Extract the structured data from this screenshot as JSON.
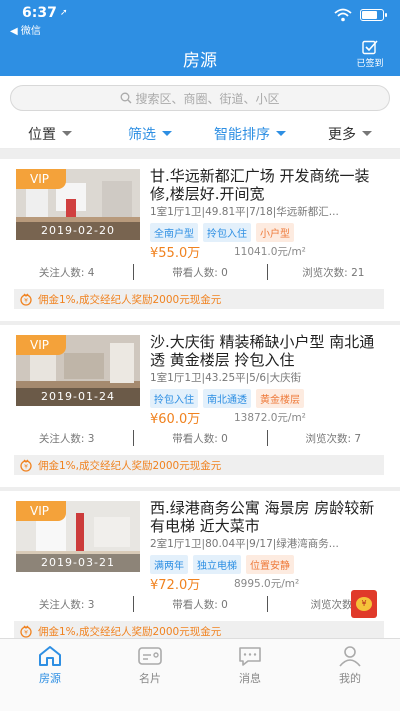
{
  "status_bar": {
    "time": "6:37",
    "back_app": "◀ 微信"
  },
  "header": {
    "title": "房源",
    "signin_label": "已签到"
  },
  "search": {
    "placeholder": "搜索区、商圈、街道、小区"
  },
  "filters": [
    {
      "label": "位置",
      "active": false
    },
    {
      "label": "筛选",
      "active": true
    },
    {
      "label": "智能排序",
      "active": true
    },
    {
      "label": "更多",
      "active": false
    }
  ],
  "listings": [
    {
      "badge": "VIP",
      "date": "2019-02-20",
      "title": "甘.华远新都汇广场 开发商统一装修,楼层好.开间宽",
      "meta": "1室1厅1卫|49.81平|7/18|华远新都汇...",
      "tags": [
        "全南户型",
        "拎包入住",
        "小户型"
      ],
      "price": "¥55.0万",
      "unit_price": "11041.0元/m²",
      "stats": {
        "followers": "关注人数: 4",
        "viewings": "带看人数: 0",
        "views": "浏览次数: 21"
      },
      "promo": "佣金1%,成交经纪人奖励2000元现金元"
    },
    {
      "badge": "VIP",
      "date": "2019-01-24",
      "title": "沙.大庆街 精装稀缺小户型 南北通透 黄金楼层 拎包入住",
      "meta": "1室1厅1卫|43.25平|5/6|大庆街",
      "tags": [
        "拎包入住",
        "南北通透",
        "黄金楼层"
      ],
      "price": "¥60.0万",
      "unit_price": "13872.0元/m²",
      "stats": {
        "followers": "关注人数: 3",
        "viewings": "带看人数: 0",
        "views": "浏览次数: 7"
      },
      "promo": "佣金1%,成交经纪人奖励2000元现金元"
    },
    {
      "badge": "VIP",
      "date": "2019-03-21",
      "title": "西.绿港商务公寓 海景房 房龄较新 有电梯 近大菜市",
      "meta": "2室1厅1卫|80.04平|9/17|绿港湾商务...",
      "tags": [
        "满两年",
        "独立电梯",
        "位置安静"
      ],
      "price": "¥72.0万",
      "unit_price": "8995.0元/m²",
      "stats": {
        "followers": "关注人数: 3",
        "viewings": "带看人数: 0",
        "views": "浏览次数: "
      },
      "promo": "佣金1%,成交经纪人奖励2000元现金元"
    }
  ],
  "tabbar": [
    {
      "label": "房源",
      "icon": "house-icon",
      "active": true
    },
    {
      "label": "名片",
      "icon": "card-icon",
      "active": false
    },
    {
      "label": "消息",
      "icon": "message-icon",
      "active": false
    },
    {
      "label": "我的",
      "icon": "person-icon",
      "active": false
    }
  ],
  "colors": {
    "brand": "#2e8fe3",
    "price": "#f0821f",
    "vip": "#f4a23a"
  }
}
